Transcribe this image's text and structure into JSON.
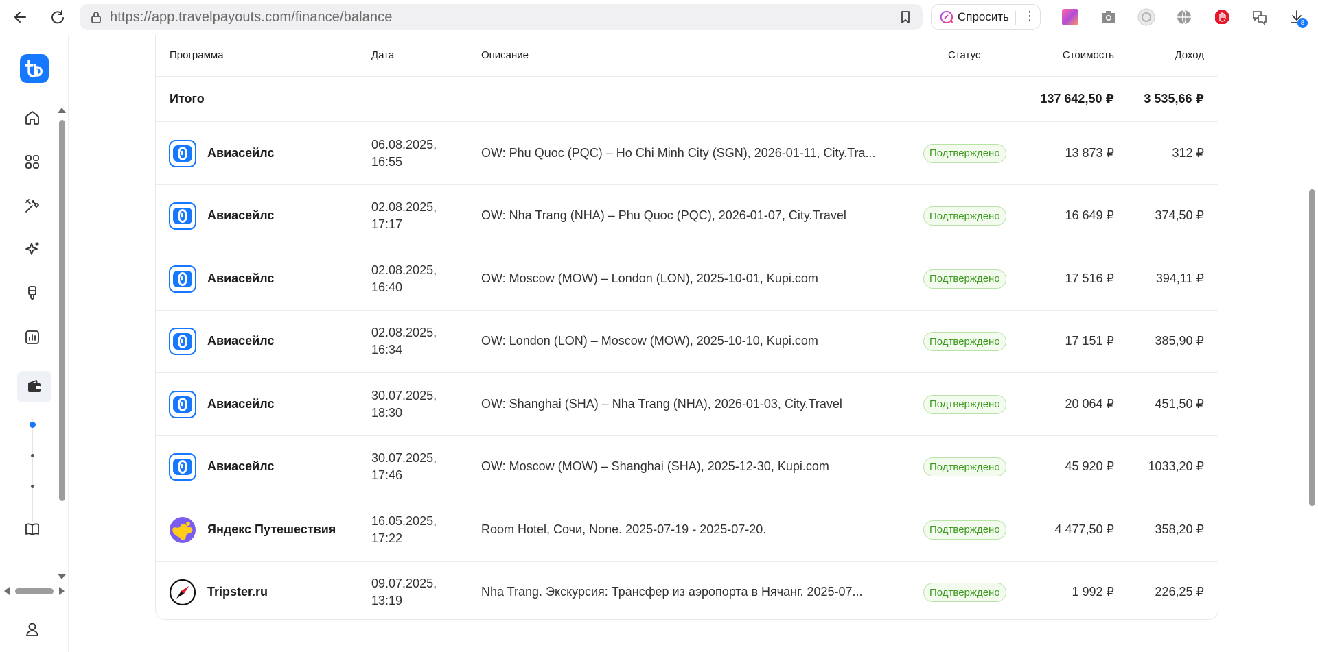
{
  "browser": {
    "url_host": "https://app.travelpayouts.com",
    "url_path": "/finance/balance",
    "ask_label": "Спросить",
    "downloads_badge": "8"
  },
  "table": {
    "headers": {
      "program": "Программа",
      "date": "Дата",
      "description": "Описание",
      "status": "Статус",
      "cost": "Стоимость",
      "income": "Доход"
    },
    "total": {
      "label": "Итого",
      "cost": "137 642,50 ₽",
      "income": "3 535,66 ₽"
    },
    "rows": [
      {
        "program": "Авиасейлс",
        "icon": "aviasales",
        "date1": "06.08.2025,",
        "date2": "16:55",
        "description": "OW: Phu Quoc (PQC) – Ho Chi Minh City (SGN), 2026-01-11, City.Tra...",
        "status": "Подтверждено",
        "cost": "13 873 ₽",
        "income": "312 ₽"
      },
      {
        "program": "Авиасейлс",
        "icon": "aviasales",
        "date1": "02.08.2025,",
        "date2": "17:17",
        "description": "OW: Nha Trang (NHA) – Phu Quoc (PQC), 2026-01-07, City.Travel",
        "status": "Подтверждено",
        "cost": "16 649 ₽",
        "income": "374,50 ₽"
      },
      {
        "program": "Авиасейлс",
        "icon": "aviasales",
        "date1": "02.08.2025,",
        "date2": "16:40",
        "description": "OW: Moscow (MOW) – London (LON), 2025-10-01, Kupi.com",
        "status": "Подтверждено",
        "cost": "17 516 ₽",
        "income": "394,11 ₽"
      },
      {
        "program": "Авиасейлс",
        "icon": "aviasales",
        "date1": "02.08.2025,",
        "date2": "16:34",
        "description": "OW: London (LON) – Moscow (MOW), 2025-10-10, Kupi.com",
        "status": "Подтверждено",
        "cost": "17 151 ₽",
        "income": "385,90 ₽"
      },
      {
        "program": "Авиасейлс",
        "icon": "aviasales",
        "date1": "30.07.2025,",
        "date2": "18:30",
        "description": "OW: Shanghai (SHA) – Nha Trang (NHA), 2026-01-03, City.Travel",
        "status": "Подтверждено",
        "cost": "20 064 ₽",
        "income": "451,50 ₽"
      },
      {
        "program": "Авиасейлс",
        "icon": "aviasales",
        "date1": "30.07.2025,",
        "date2": "17:46",
        "description": "OW: Moscow (MOW) – Shanghai (SHA), 2025-12-30, Kupi.com",
        "status": "Подтверждено",
        "cost": "45 920 ₽",
        "income": "1033,20 ₽"
      },
      {
        "program": "Яндекс Путешествия",
        "icon": "yandex-travel",
        "date1": "16.05.2025,",
        "date2": "17:22",
        "description": "Room Hotel, Сочи, None. 2025-07-19 - 2025-07-20.",
        "status": "Подтверждено",
        "cost": "4 477,50 ₽",
        "income": "358,20 ₽"
      },
      {
        "program": "Tripster.ru",
        "icon": "tripster",
        "date1": "09.07.2025,",
        "date2": "13:19",
        "description": "Nha Trang. Экскурсия: Трансфер из аэропорта в Нячанг. 2025-07...",
        "status": "Подтверждено",
        "cost": "1 992 ₽",
        "income": "226,25 ₽"
      }
    ]
  },
  "colors": {
    "brand": "#1677ff",
    "status_green": "#3c9a1e"
  }
}
